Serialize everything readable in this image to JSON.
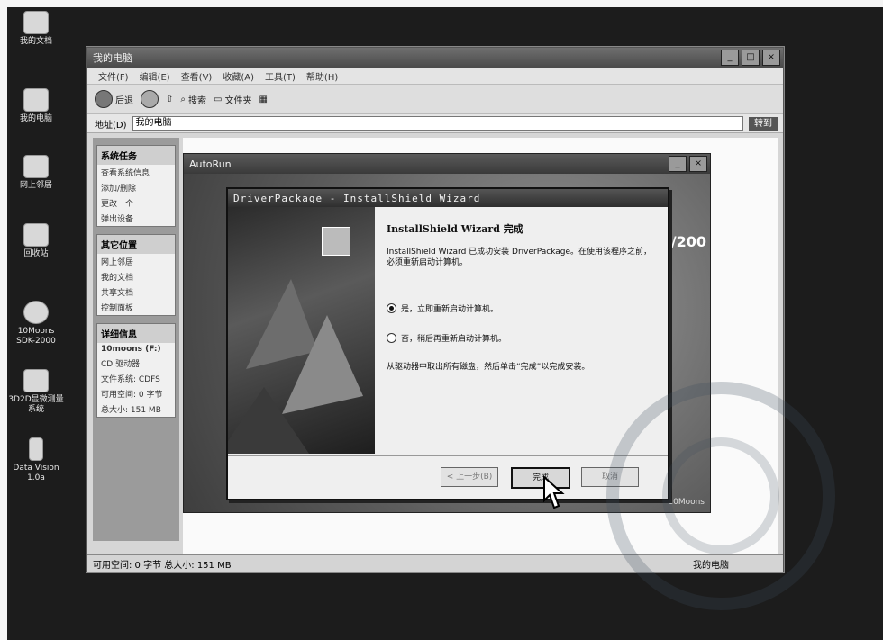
{
  "desktop": {
    "icons": [
      {
        "label": "我的文档",
        "icon": "documents-icon"
      },
      {
        "label": "我的电脑",
        "icon": "computer-icon"
      },
      {
        "label": "网上邻居",
        "icon": "network-icon"
      },
      {
        "label": "回收站",
        "icon": "recycle-bin-icon"
      },
      {
        "label": "10Moons SDK-2000",
        "icon": "cd-drive-icon"
      },
      {
        "label": "3D2D显微测量系统",
        "icon": "measure-app-icon"
      },
      {
        "label": "Data Vision 1.0a",
        "icon": "data-vision-icon"
      }
    ]
  },
  "explorer": {
    "title": "我的电脑",
    "menu": [
      "文件(F)",
      "编辑(E)",
      "查看(V)",
      "收藏(A)",
      "工具(T)",
      "帮助(H)"
    ],
    "toolbar": {
      "back": "后退",
      "search": "搜索",
      "folders": "文件夹"
    },
    "address_label": "地址(D)",
    "address_value": "我的电脑",
    "go_label": "转到",
    "panels": [
      {
        "title": "系统任务",
        "items": [
          "查看系统信息",
          "添加/删除",
          "更改一个",
          "弹出设备"
        ]
      },
      {
        "title": "其它位置",
        "items": [
          "网上邻居",
          "我的文档",
          "共享文档",
          "控制面板"
        ]
      },
      {
        "title": "详细信息",
        "items": [
          "10moons (F:)",
          "CD 驱动器",
          "文件系统: CDFS",
          "可用空间: 0 字节",
          "总大小: 151 MB"
        ]
      }
    ],
    "status_left": "可用空间: 0 字节 总大小: 151 MB",
    "status_right": "我的电脑"
  },
  "behind_window": {
    "title": "AutoRun",
    "version_fragment": "/200",
    "footer": "10Moons"
  },
  "wizard": {
    "title": "DriverPackage - InstallShield Wizard",
    "heading": "InstallShield Wizard 完成",
    "description": "InstallShield Wizard 已成功安装 DriverPackage。在使用该程序之前，必须重新启动计算机。",
    "option_yes": "是，立即重新启动计算机。",
    "option_no": "否，稍后再重新启动计算机。",
    "selected": "yes",
    "note": "从驱动器中取出所有磁盘，然后单击“完成”以完成安装。",
    "buttons": {
      "back": "< 上一步(B)",
      "finish": "完成",
      "cancel": "取消"
    }
  }
}
